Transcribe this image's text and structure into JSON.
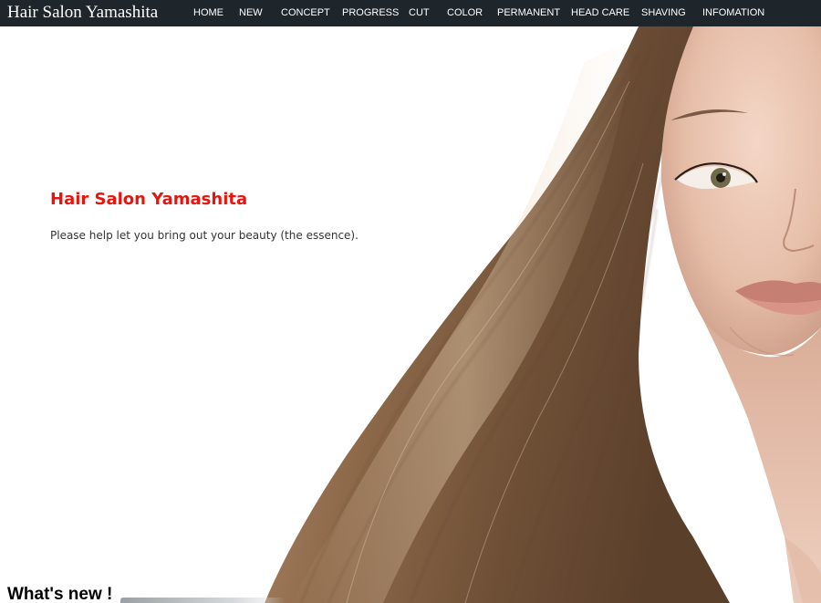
{
  "header": {
    "brand": "Hair Salon Yamashita",
    "nav": [
      {
        "label": "HOME"
      },
      {
        "label": "NEW"
      },
      {
        "label": "CONCEPT"
      },
      {
        "label": "PROGRESS"
      },
      {
        "label": "CUT"
      },
      {
        "label": "COLOR"
      },
      {
        "label": "PERMANENT"
      },
      {
        "label": "HEAD CARE"
      },
      {
        "label": "SHAVING"
      },
      {
        "label": "INFOMATION"
      }
    ]
  },
  "hero": {
    "title": "Hair Salon Yamashita",
    "text": "Please help let you bring out your beauty (the essence).",
    "image_subject": "woman-with-long-hair"
  },
  "sections": {
    "whats_new_heading": "What's new !"
  },
  "colors": {
    "navbar_bg": "#1e262c",
    "accent_red": "#e8150f",
    "hair_brown": "#8a6a4c",
    "skin": "#e8c4b0"
  }
}
